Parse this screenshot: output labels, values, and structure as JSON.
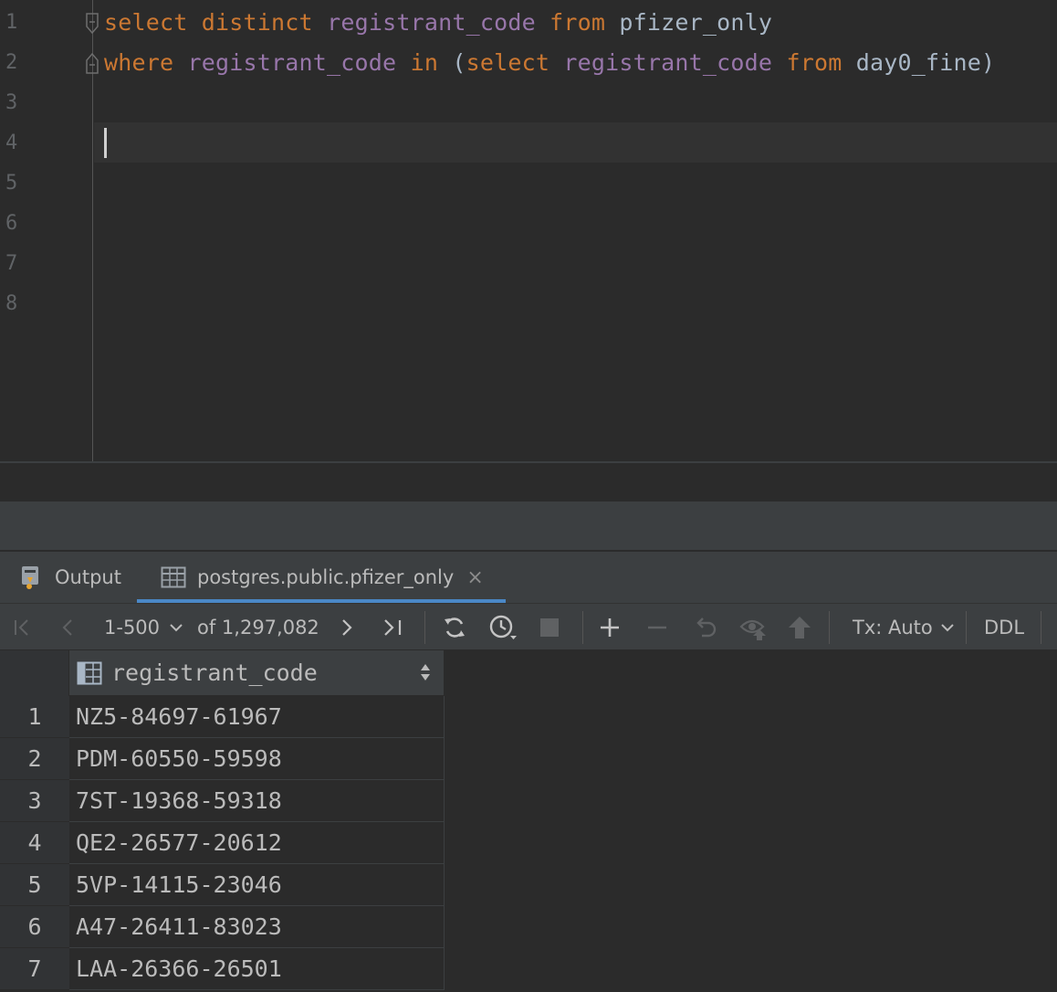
{
  "editor": {
    "line_numbers": [
      "1",
      "2",
      "3",
      "4",
      "5",
      "6",
      "7",
      "8"
    ],
    "line1": {
      "kw_select": "select",
      "kw_distinct": "distinct",
      "col": "registrant_code",
      "kw_from": "from",
      "table": "pfizer_only"
    },
    "line2": {
      "kw_where": "where",
      "col": "registrant_code",
      "kw_in": "in",
      "paren_open": "(",
      "kw_select": "select",
      "col2": "registrant_code",
      "kw_from": "from",
      "table": "day0_fine",
      "paren_close": ")"
    }
  },
  "tabs": {
    "output_label": "Output",
    "table_label": "postgres.public.pfizer_only",
    "close_glyph": "×"
  },
  "toolbar": {
    "page_range": "1-500",
    "total": "of 1,297,082",
    "tx_label": "Tx: Auto",
    "ddl_label": "DDL"
  },
  "grid": {
    "column_header": "registrant_code",
    "rows": [
      {
        "num": "1",
        "value": "NZ5-84697-61967"
      },
      {
        "num": "2",
        "value": "PDM-60550-59598"
      },
      {
        "num": "3",
        "value": "7ST-19368-59318"
      },
      {
        "num": "4",
        "value": "QE2-26577-20612"
      },
      {
        "num": "5",
        "value": "5VP-14115-23046"
      },
      {
        "num": "6",
        "value": "A47-26411-83023"
      },
      {
        "num": "7",
        "value": "LAA-26366-26501"
      }
    ]
  },
  "colors": {
    "keyword": "#cc7832",
    "identifier": "#9876aa",
    "text": "#a9b7c6",
    "accent": "#4a88c7"
  }
}
